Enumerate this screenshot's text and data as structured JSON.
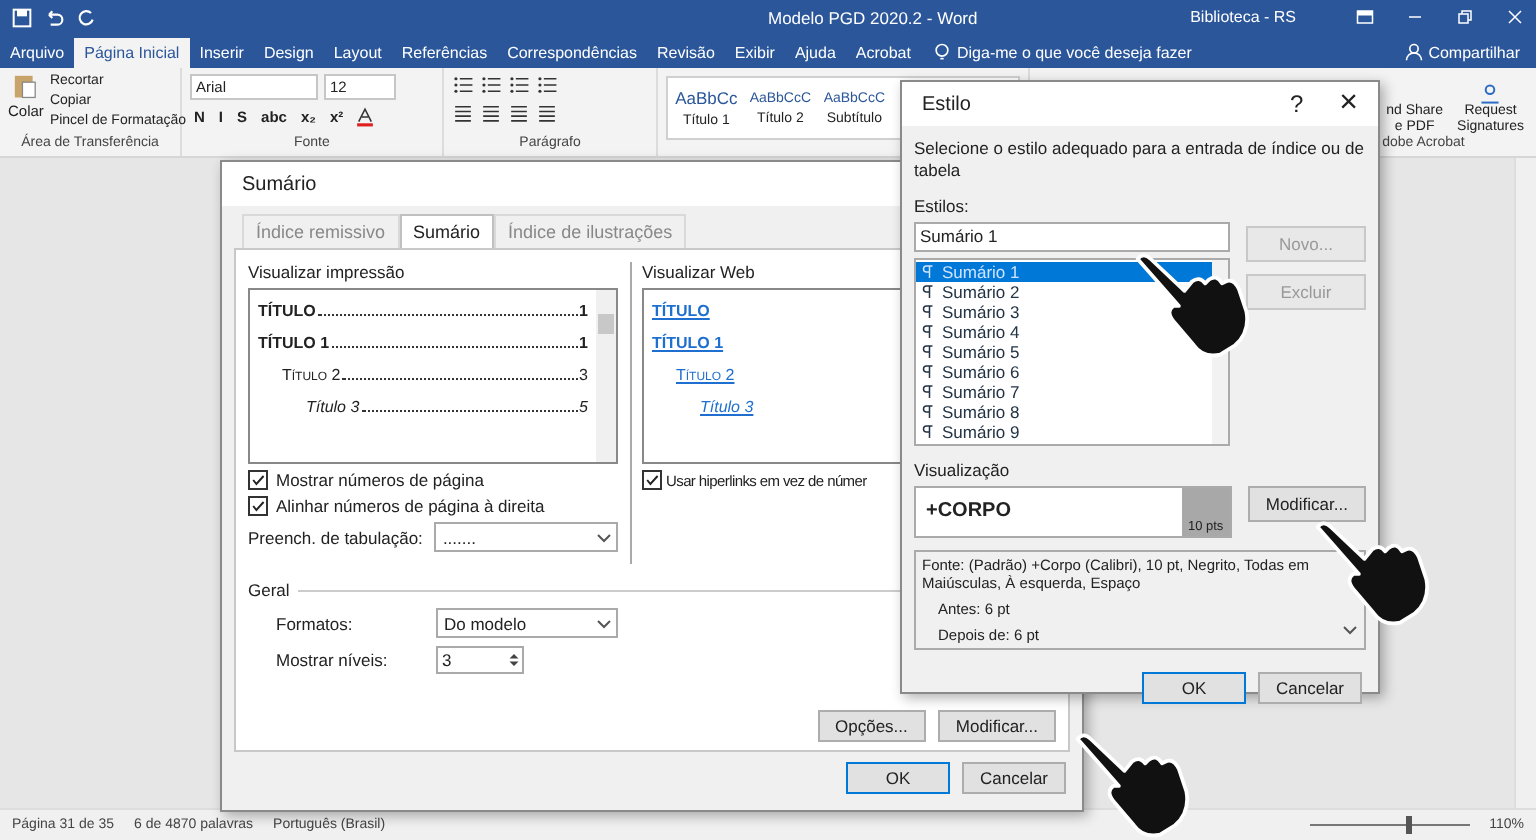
{
  "window": {
    "title": "Modelo PGD 2020.2  -  Word",
    "account": "Biblioteca - RS"
  },
  "menu_tabs": [
    {
      "label": "Arquivo",
      "selected": false
    },
    {
      "label": "Página Inicial",
      "selected": true
    },
    {
      "label": "Inserir",
      "selected": false
    },
    {
      "label": "Design",
      "selected": false
    },
    {
      "label": "Layout",
      "selected": false
    },
    {
      "label": "Referências",
      "selected": false
    },
    {
      "label": "Correspondências",
      "selected": false
    },
    {
      "label": "Revisão",
      "selected": false
    },
    {
      "label": "Exibir",
      "selected": false
    },
    {
      "label": "Ajuda",
      "selected": false
    },
    {
      "label": "Acrobat",
      "selected": false
    }
  ],
  "tell_me": "Diga-me o que você deseja fazer",
  "share": "Compartilhar",
  "ribbon": {
    "clipboard": {
      "paste": "Colar",
      "items": [
        "Recortar",
        "Copiar",
        "Pincel de Formatação"
      ],
      "label": "Área de Transferência"
    },
    "font": {
      "name": "Arial",
      "size": "12",
      "format_buttons": [
        "N",
        "I",
        "S",
        "abc",
        "x₂",
        "x²"
      ],
      "label": "Fonte"
    },
    "paragraph": {
      "label": "Parágrafo"
    },
    "styles": [
      {
        "preview": "AaBbCc",
        "name": "Título 1"
      },
      {
        "preview": "AaBbCcC",
        "name": "Título 2"
      },
      {
        "preview": "AaBbCcC",
        "name": "Subtítulo"
      }
    ],
    "acrobat": {
      "share": [
        "nd Share",
        "e PDF"
      ],
      "request": [
        "Request",
        "Signatures"
      ],
      "label": "dobe Acrobat"
    }
  },
  "toc_dialog": {
    "title": "Sumário",
    "tabs": [
      {
        "label": "Índice remissivo",
        "selected": false
      },
      {
        "label": "Sumário",
        "selected": true
      },
      {
        "label": "Índice de ilustrações",
        "selected": false
      }
    ],
    "print_label": "Visualizar impressão",
    "print_entries": [
      {
        "kind": "bold",
        "text": "TÍTULO",
        "page": "1"
      },
      {
        "kind": "bold",
        "text": "TÍTULO 1",
        "page": "1"
      },
      {
        "kind": "smallcaps",
        "text": "Título 2",
        "page": "3"
      },
      {
        "kind": "italic",
        "text": "Título 3",
        "page": "5"
      }
    ],
    "web_label": "Visualizar Web",
    "web_entries": [
      {
        "kind": "bold",
        "text": "TÍTULO"
      },
      {
        "kind": "bold",
        "text": "TÍTULO 1"
      },
      {
        "kind": "smallcaps",
        "text": "Título 2"
      },
      {
        "kind": "italic",
        "text": "Título 3"
      }
    ],
    "options": [
      {
        "label": "Mostrar números de página",
        "checked": true
      },
      {
        "label": "Alinhar números de página à direita",
        "checked": true
      }
    ],
    "web_option": {
      "label": "Usar hiperlinks em vez de númer",
      "checked": true
    },
    "tab_leader": {
      "label": "Preench. de tabulação:",
      "value": "......."
    },
    "general_label": "Geral",
    "formats": {
      "label": "Formatos:",
      "value": "Do modelo"
    },
    "levels": {
      "label": "Mostrar níveis:",
      "value": "3"
    },
    "buttons": [
      "Opções...",
      "Modificar..."
    ],
    "ok": "OK",
    "cancel": "Cancelar"
  },
  "style_dialog": {
    "title": "Estilo",
    "help": "?",
    "close": "×",
    "instruction": "Selecione o estilo adequado para a entrada de índice ou de tabela",
    "styles_label": "Estilos:",
    "styles_value": "Sumário 1",
    "styles": [
      {
        "label": "Sumário 1",
        "selected": true
      },
      {
        "label": "Sumário 2",
        "selected": false
      },
      {
        "label": "Sumário 3",
        "selected": false
      },
      {
        "label": "Sumário 4",
        "selected": false
      },
      {
        "label": "Sumário 5",
        "selected": false
      },
      {
        "label": "Sumário 6",
        "selected": false
      },
      {
        "label": "Sumário 7",
        "selected": false
      },
      {
        "label": "Sumário 8",
        "selected": false
      },
      {
        "label": "Sumário 9",
        "selected": false
      }
    ],
    "new_button": {
      "label": "Novo...",
      "disabled": true
    },
    "delete_button": {
      "label": "Excluir",
      "disabled": true
    },
    "preview_label": "Visualização",
    "preview_text": "+CORPO",
    "preview_size": "10 pts",
    "modify": "Modificar...",
    "description": [
      "Fonte: (Padrão) +Corpo (Calibri), 10 pt, Negrito, Todas em Maiúsculas, À esquerda, Espaço",
      "Antes:  6 pt",
      "Depois de:  6 pt"
    ],
    "ok": "OK",
    "cancel": "Cancelar"
  },
  "status_bar": {
    "page": "Página 31 de 35",
    "words": "6 de 4870 palavras",
    "language": "Português (Brasil)",
    "zoom": "110%",
    "zoom_level": {
      "level": 0.6
    }
  }
}
